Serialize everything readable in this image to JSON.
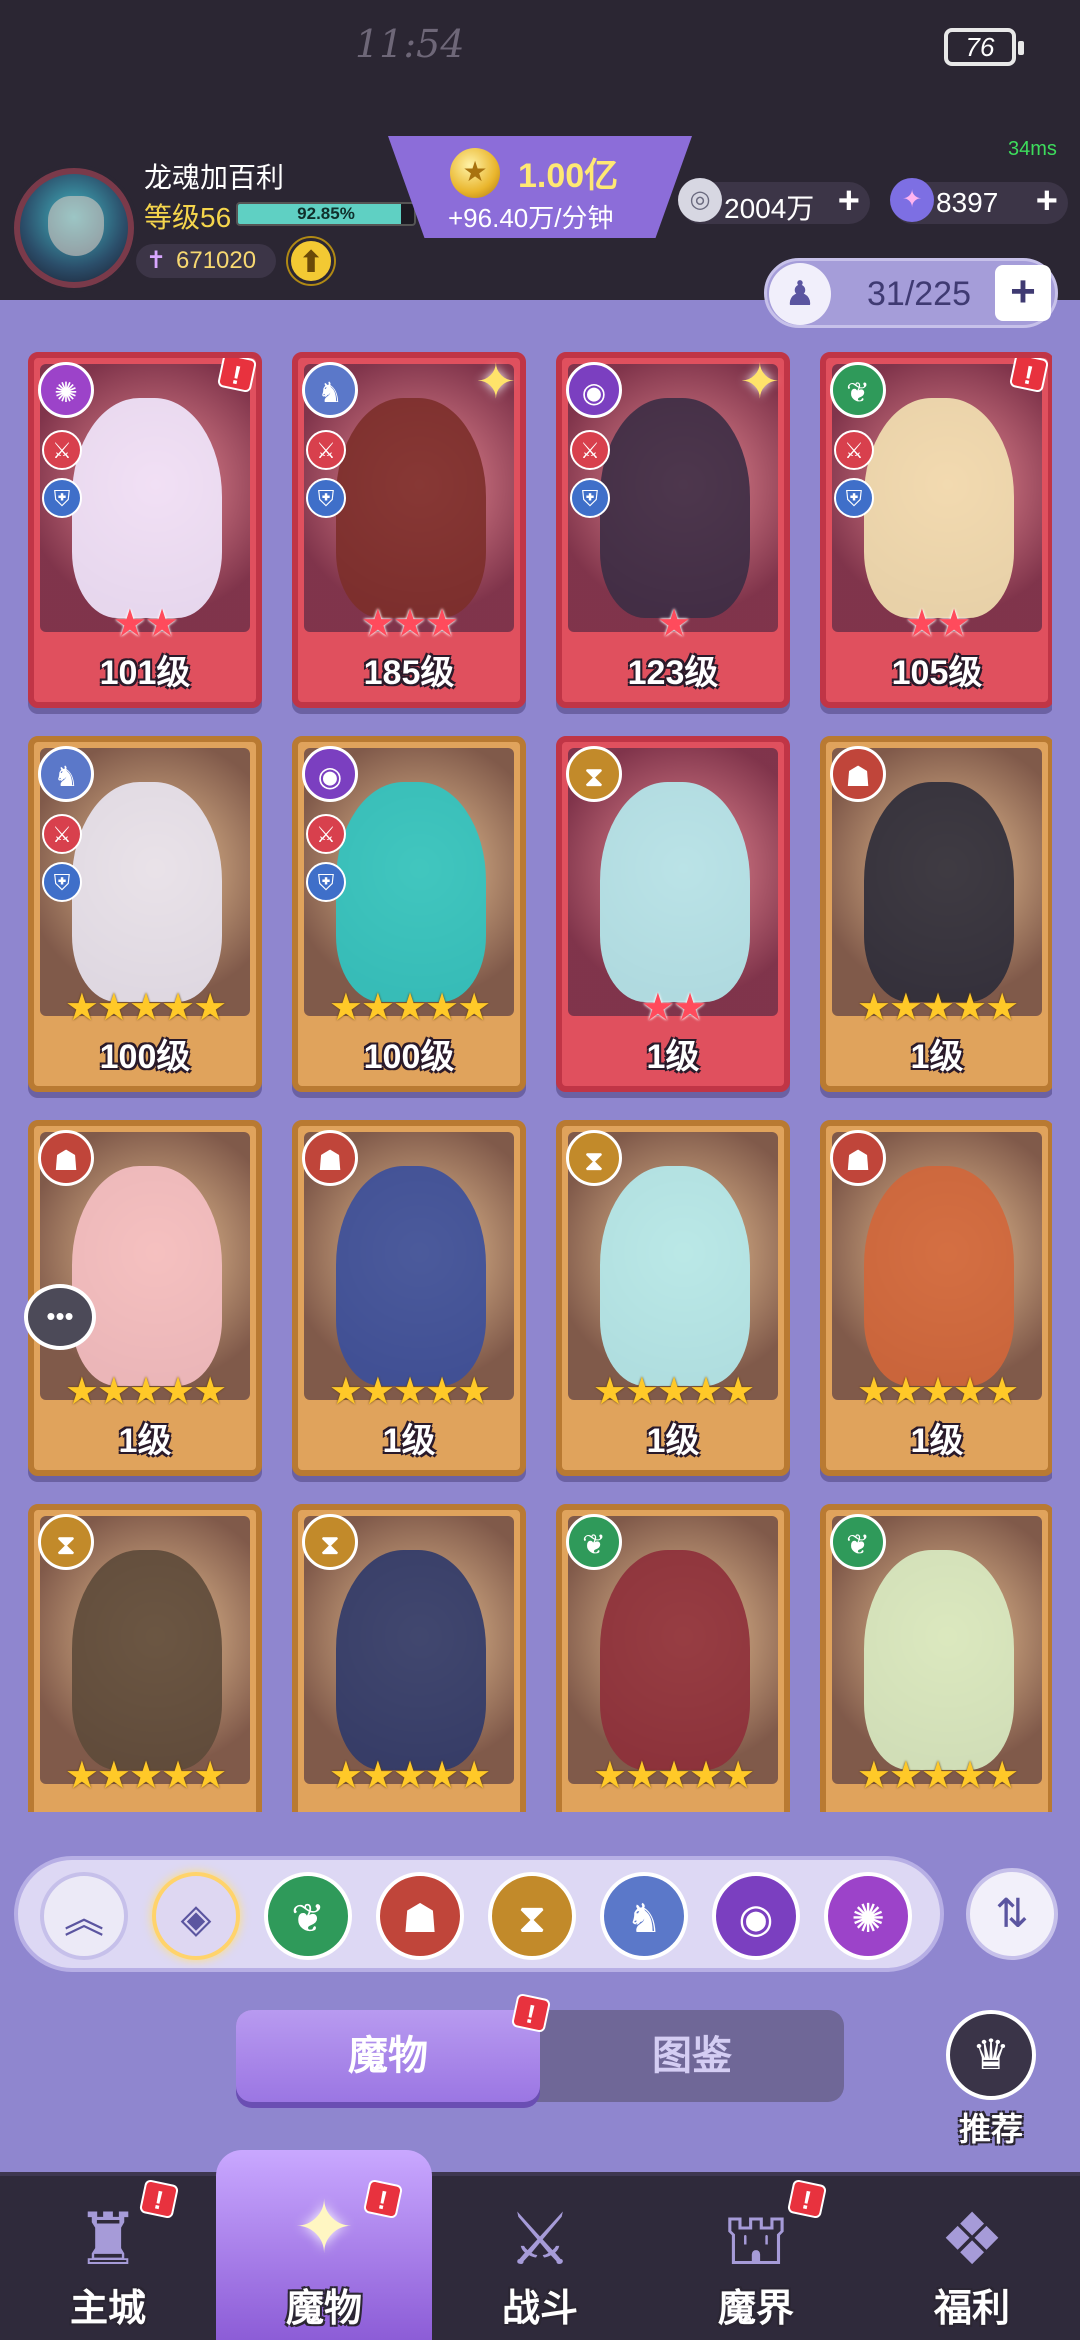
{
  "status_bar": {
    "time": "11:54",
    "battery": "76",
    "ping": "34ms"
  },
  "player": {
    "name": "龙魂加百利",
    "level": "等级56",
    "exp_text": "92.85%",
    "exp_fraction": 0.9285,
    "power": "671020"
  },
  "gold": {
    "amount": "1.00亿",
    "rate": "+96.40万/分钟"
  },
  "resources": [
    {
      "name": "silver-coin-icon",
      "value": "2004万"
    },
    {
      "name": "star-gem-icon",
      "value": "8397"
    }
  ],
  "capacity": {
    "value": "31/225",
    "plus": "+"
  },
  "cards": [
    {
      "level": "101级",
      "stars": "★★",
      "frame": "red",
      "faction": "f-spiral",
      "faction_icon": "✺",
      "figure_color": "#f2e9ff",
      "alert": true,
      "sparkle": false,
      "badges": true
    },
    {
      "level": "185级",
      "stars": "★★★",
      "frame": "red",
      "faction": "f-dragon",
      "faction_icon": "♞",
      "figure_color": "#7c2f2a",
      "alert": false,
      "sparkle": true,
      "badges": true
    },
    {
      "level": "123级",
      "stars": "★",
      "frame": "red",
      "faction": "f-eye",
      "faction_icon": "◉",
      "figure_color": "#3c2d45",
      "alert": false,
      "sparkle": true,
      "badges": true
    },
    {
      "level": "105级",
      "stars": "★★",
      "frame": "red",
      "faction": "f-leaf",
      "faction_icon": "❦",
      "figure_color": "#f3e2b2",
      "alert": true,
      "sparkle": false,
      "badges": true
    },
    {
      "level": "100级",
      "stars": "★★★★★",
      "frame": "gold",
      "faction": "f-dragon",
      "faction_icon": "♞",
      "figure_color": "#e9e6f2",
      "alert": false,
      "sparkle": false,
      "badges": true
    },
    {
      "level": "100级",
      "stars": "★★★★★",
      "frame": "gold",
      "faction": "f-eye",
      "faction_icon": "◉",
      "figure_color": "#2fc7c3",
      "alert": false,
      "sparkle": false,
      "badges": true
    },
    {
      "level": "1级",
      "stars": "★★",
      "frame": "red",
      "faction": "f-hourglass",
      "faction_icon": "⧗",
      "figure_color": "#b5ecef",
      "alert": false,
      "sparkle": false,
      "badges": false
    },
    {
      "level": "1级",
      "stars": "★★★★★",
      "frame": "gold",
      "faction": "f-mask",
      "faction_icon": "☗",
      "figure_color": "#2c2c3a",
      "alert": false,
      "sparkle": false,
      "badges": false
    },
    {
      "level": "1级",
      "stars": "★★★★★",
      "frame": "gold",
      "faction": "f-mask",
      "faction_icon": "☗",
      "figure_color": "#f6c0c4",
      "alert": false,
      "sparkle": false,
      "badges": false
    },
    {
      "level": "1级",
      "stars": "★★★★★",
      "frame": "gold",
      "faction": "f-mask",
      "faction_icon": "☗",
      "figure_color": "#3a4f9c",
      "alert": false,
      "sparkle": false,
      "badges": false
    },
    {
      "level": "1级",
      "stars": "★★★★★",
      "frame": "gold",
      "faction": "f-hourglass",
      "faction_icon": "⧗",
      "figure_color": "#b5ecef",
      "alert": false,
      "sparkle": false,
      "badges": false
    },
    {
      "level": "1级",
      "stars": "★★★★★",
      "frame": "gold",
      "faction": "f-mask",
      "faction_icon": "☗",
      "figure_color": "#d2663a",
      "alert": false,
      "sparkle": false,
      "badges": false
    },
    {
      "level": "",
      "stars": "★★★★★",
      "frame": "gold",
      "faction": "f-hourglass",
      "faction_icon": "⧗",
      "figure_color": "#5d4a3a",
      "alert": false,
      "sparkle": false,
      "badges": false
    },
    {
      "level": "",
      "stars": "★★★★★",
      "frame": "gold",
      "faction": "f-hourglass",
      "faction_icon": "⧗",
      "figure_color": "#2f3a6a",
      "alert": false,
      "sparkle": false,
      "badges": false
    },
    {
      "level": "",
      "stars": "★★★★★",
      "frame": "gold",
      "faction": "f-leaf",
      "faction_icon": "❦",
      "figure_color": "#8e2f3a",
      "alert": false,
      "sparkle": false,
      "badges": false
    },
    {
      "level": "",
      "stars": "★★★★★",
      "frame": "gold",
      "faction": "f-leaf",
      "faction_icon": "❦",
      "figure_color": "#d9ecc3",
      "alert": false,
      "sparkle": false,
      "badges": false
    }
  ],
  "filters": [
    {
      "name": "filter-collapse-button",
      "icon": "︽",
      "cls": "filter-collapse"
    },
    {
      "name": "filter-all-button",
      "icon": "◈",
      "cls": "filter-all"
    },
    {
      "name": "filter-leaf-button",
      "icon": "❦",
      "cls": "f-leaf"
    },
    {
      "name": "filter-mask-button",
      "icon": "☗",
      "cls": "f-mask"
    },
    {
      "name": "filter-hourglass-button",
      "icon": "⧗",
      "cls": "f-hourglass"
    },
    {
      "name": "filter-dragon-button",
      "icon": "♞",
      "cls": "f-dragon"
    },
    {
      "name": "filter-eye-button",
      "icon": "◉",
      "cls": "f-eye"
    },
    {
      "name": "filter-spiral-button",
      "icon": "✺",
      "cls": "f-spiral"
    }
  ],
  "tabs": {
    "monsters": "魔物",
    "codex": "图鉴"
  },
  "recommend": {
    "label": "推荐"
  },
  "nav": [
    {
      "label": "主城",
      "icon": "♜",
      "alert": true,
      "active": false
    },
    {
      "label": "魔物",
      "icon": "✦",
      "alert": true,
      "active": true
    },
    {
      "label": "战斗",
      "icon": "⚔",
      "alert": false,
      "active": false
    },
    {
      "label": "魔界",
      "icon": "⛫",
      "alert": true,
      "active": false
    },
    {
      "label": "福利",
      "icon": "❖",
      "alert": false,
      "active": false
    }
  ]
}
